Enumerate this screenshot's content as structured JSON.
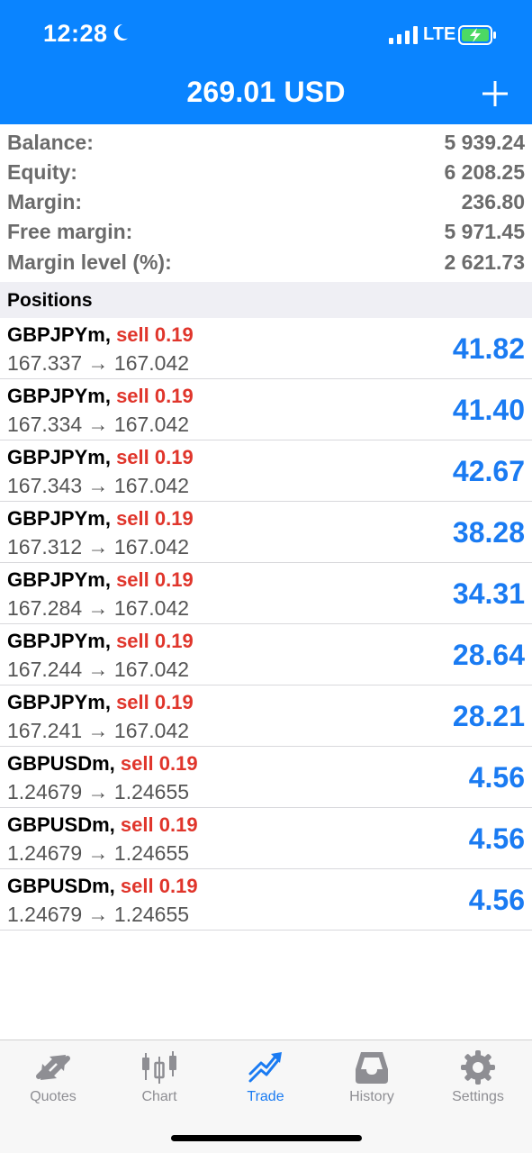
{
  "status_bar": {
    "time": "12:28",
    "network": "LTE"
  },
  "header": {
    "title": "269.01 USD"
  },
  "summary": [
    {
      "label": "Balance:",
      "value": "5 939.24"
    },
    {
      "label": "Equity:",
      "value": "6 208.25"
    },
    {
      "label": "Margin:",
      "value": "236.80"
    },
    {
      "label": "Free margin:",
      "value": "5 971.45"
    },
    {
      "label": "Margin level (%):",
      "value": "2 621.73"
    }
  ],
  "positions_title": "Positions",
  "positions": [
    {
      "symbol": "GBPJPYm,",
      "side": "sell 0.19",
      "prices": "167.337 → 167.042",
      "profit": "41.82"
    },
    {
      "symbol": "GBPJPYm,",
      "side": "sell 0.19",
      "prices": "167.334 → 167.042",
      "profit": "41.40"
    },
    {
      "symbol": "GBPJPYm,",
      "side": "sell 0.19",
      "prices": "167.343 → 167.042",
      "profit": "42.67"
    },
    {
      "symbol": "GBPJPYm,",
      "side": "sell 0.19",
      "prices": "167.312 → 167.042",
      "profit": "38.28"
    },
    {
      "symbol": "GBPJPYm,",
      "side": "sell 0.19",
      "prices": "167.284 → 167.042",
      "profit": "34.31"
    },
    {
      "symbol": "GBPJPYm,",
      "side": "sell 0.19",
      "prices": "167.244 → 167.042",
      "profit": "28.64"
    },
    {
      "symbol": "GBPJPYm,",
      "side": "sell 0.19",
      "prices": "167.241 → 167.042",
      "profit": "28.21"
    },
    {
      "symbol": "GBPUSDm,",
      "side": "sell 0.19",
      "prices": "1.24679 → 1.24655",
      "profit": "4.56"
    },
    {
      "symbol": "GBPUSDm,",
      "side": "sell 0.19",
      "prices": "1.24679 → 1.24655",
      "profit": "4.56"
    },
    {
      "symbol": "GBPUSDm,",
      "side": "sell 0.19",
      "prices": "1.24679 → 1.24655",
      "profit": "4.56"
    }
  ],
  "tabs": [
    {
      "label": "Quotes",
      "icon": "quotes-icon",
      "active": false
    },
    {
      "label": "Chart",
      "icon": "candlestick-chart-icon",
      "active": false
    },
    {
      "label": "Trade",
      "icon": "trade-trend-icon",
      "active": true
    },
    {
      "label": "History",
      "icon": "inbox-history-icon",
      "active": false
    },
    {
      "label": "Settings",
      "icon": "gear-icon",
      "active": false
    }
  ],
  "colors": {
    "accent": "#0a84ff",
    "sell": "#e0352b",
    "profit": "#1a7bf2",
    "inactive": "#8e8e93"
  }
}
